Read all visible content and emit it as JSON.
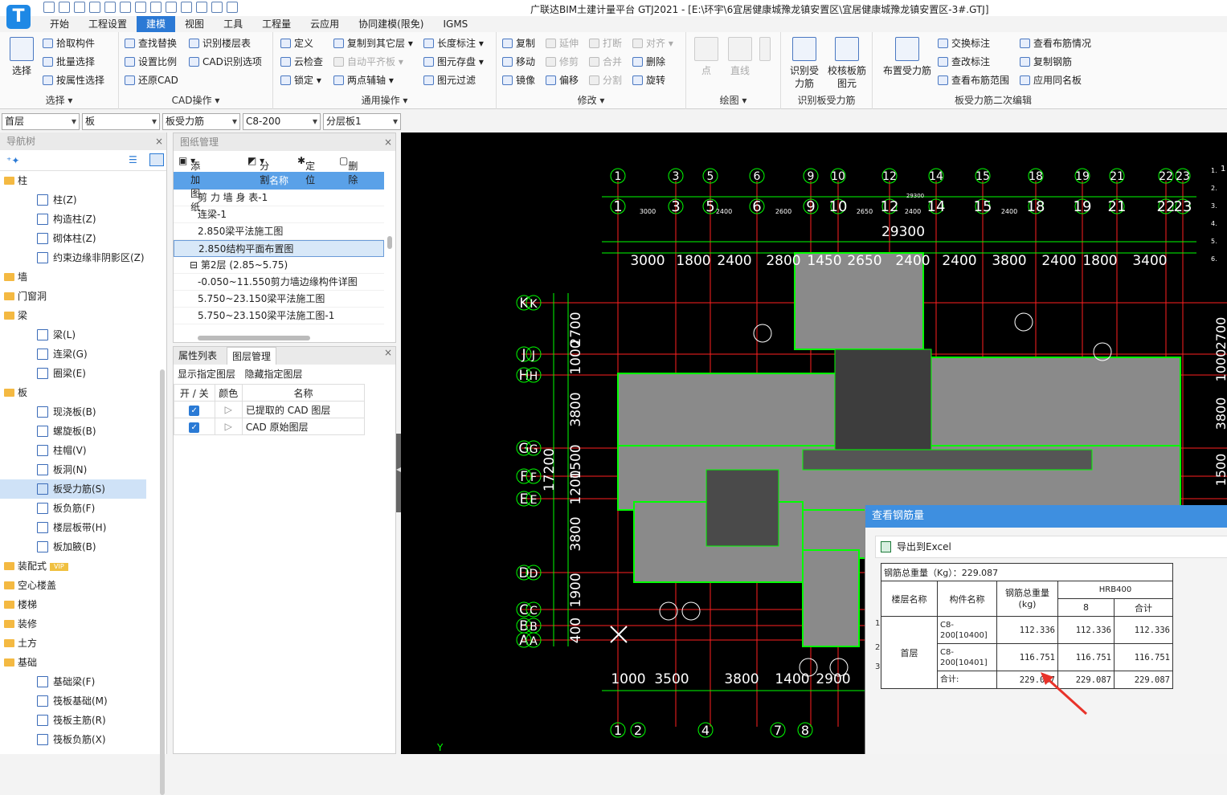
{
  "app": {
    "title": "广联达BIM土建计量平台 GTJ2021 - [E:\\环宇\\6宜居健康城豫龙镇安置区\\宜居健康城豫龙镇安置区-3#.GTJ]",
    "logo": "T"
  },
  "tabs": [
    "开始",
    "工程设置",
    "建模",
    "视图",
    "工具",
    "工程量",
    "云应用",
    "协同建模(限免)",
    "IGMS"
  ],
  "active_tab": "建模",
  "ribbon": {
    "select": {
      "label": "选择",
      "big": "选择",
      "items": [
        "拾取构件",
        "批量选择",
        "按属性选择"
      ]
    },
    "cad": {
      "label": "CAD操作",
      "items": [
        "查找替换",
        "设置比例",
        "还原CAD",
        "识别楼层表",
        "CAD识别选项"
      ]
    },
    "common": {
      "label": "通用操作",
      "items": [
        "定义",
        "云检查",
        "锁定",
        "复制到其它层",
        "自动平齐板",
        "两点辅轴",
        "长度标注",
        "图元存盘",
        "图元过滤"
      ]
    },
    "modify": {
      "label": "修改",
      "items": [
        "复制",
        "移动",
        "镜像",
        "延伸",
        "修剪",
        "偏移",
        "打断",
        "合并",
        "分割",
        "对齐",
        "删除",
        "旋转"
      ]
    },
    "draw": {
      "label": "绘图",
      "items": [
        "点",
        "直线"
      ]
    },
    "recog": {
      "label": "识别板受力筋",
      "items": [
        "识别受力筋",
        "校核板筋图元"
      ]
    },
    "secondary": {
      "label": "板受力筋二次编辑",
      "big": "布置受力筋",
      "items": [
        "交换标注",
        "查改标注",
        "查看布筋范围",
        "查看布筋情况",
        "复制钢筋",
        "应用同名板"
      ]
    }
  },
  "selectors": [
    "首层",
    "板",
    "板受力筋",
    "C8-200",
    "分层板1"
  ],
  "nav": {
    "title": "导航树",
    "items": [
      {
        "t": "g",
        "label": "柱"
      },
      {
        "t": "c",
        "label": "柱(Z)"
      },
      {
        "t": "c",
        "label": "构造柱(Z)"
      },
      {
        "t": "c",
        "label": "砌体柱(Z)"
      },
      {
        "t": "c",
        "label": "约束边缘非阴影区(Z)"
      },
      {
        "t": "g",
        "label": "墙"
      },
      {
        "t": "g",
        "label": "门窗洞"
      },
      {
        "t": "g",
        "label": "梁"
      },
      {
        "t": "c",
        "label": "梁(L)"
      },
      {
        "t": "c",
        "label": "连梁(G)"
      },
      {
        "t": "c",
        "label": "圈梁(E)"
      },
      {
        "t": "g",
        "label": "板"
      },
      {
        "t": "c",
        "label": "现浇板(B)"
      },
      {
        "t": "c",
        "label": "螺旋板(B)"
      },
      {
        "t": "c",
        "label": "柱帽(V)"
      },
      {
        "t": "c",
        "label": "板洞(N)"
      },
      {
        "t": "c",
        "label": "板受力筋(S)",
        "sel": true
      },
      {
        "t": "c",
        "label": "板负筋(F)"
      },
      {
        "t": "c",
        "label": "楼层板带(H)"
      },
      {
        "t": "c",
        "label": "板加腋(B)"
      },
      {
        "t": "g",
        "label": "装配式",
        "vip": "VIP"
      },
      {
        "t": "g",
        "label": "空心楼盖"
      },
      {
        "t": "g",
        "label": "楼梯"
      },
      {
        "t": "g",
        "label": "装修"
      },
      {
        "t": "g",
        "label": "土方"
      },
      {
        "t": "g",
        "label": "基础"
      },
      {
        "t": "c",
        "label": "基础梁(F)"
      },
      {
        "t": "c",
        "label": "筏板基础(M)"
      },
      {
        "t": "c",
        "label": "筏板主筋(R)"
      },
      {
        "t": "c",
        "label": "筏板负筋(X)"
      }
    ]
  },
  "drawings": {
    "title": "图纸管理",
    "tools": [
      "添加图纸",
      "分割",
      "定位",
      "删除"
    ],
    "col": "名称",
    "rows": [
      {
        "label": "剪 力 墙 身 表-1"
      },
      {
        "label": "连梁-1"
      },
      {
        "label": "2.850梁平法施工图"
      },
      {
        "label": "2.850结构平面布置图",
        "sel": true
      },
      {
        "label": "第2层 (2.85~5.75)",
        "grp": true
      },
      {
        "label": "-0.050~11.550剪力墙边缘构件详图"
      },
      {
        "label": "5.750~23.150梁平法施工图"
      },
      {
        "label": "5.750~23.150梁平法施工图-1"
      }
    ]
  },
  "layers": {
    "tabs": [
      "属性列表",
      "图层管理"
    ],
    "ops": [
      "显示指定图层",
      "隐藏指定图层"
    ],
    "headers": [
      "开 / 关",
      "颜色",
      "名称"
    ],
    "rows": [
      "已提取的 CAD 图层",
      "CAD 原始图层"
    ]
  },
  "cad": {
    "axes_top": [
      "1",
      "3",
      "5",
      "6",
      "9",
      "10",
      "12",
      "14",
      "15",
      "18",
      "19",
      "21",
      "22",
      "23"
    ],
    "dims_top": [
      "3000",
      "1800",
      "2400",
      "2800",
      "1450",
      "2650",
      "2400",
      "2400",
      "3800",
      "2400",
      "1800",
      "3400"
    ],
    "dims_top_small": [
      "3000",
      "2400",
      "2600",
      "2650",
      "2400",
      "2400"
    ],
    "total_top": "29300",
    "total_top_small": "29300",
    "axes_left": [
      "K",
      "J",
      "H",
      "G",
      "F",
      "E",
      "D",
      "C",
      "B",
      "A"
    ],
    "dims_left": [
      "2700",
      "1000",
      "3800",
      "1500",
      "1200",
      "3800",
      "1900",
      "400"
    ],
    "total_left": "17200",
    "axes_bottom": [
      "1",
      "2",
      "4",
      "7",
      "8"
    ],
    "dims_bottom": [
      "1000",
      "3500",
      "3800",
      "1400",
      "2900"
    ],
    "right_axis": "1",
    "rightdims": [
      "2700",
      "1000",
      "3800",
      "1500"
    ],
    "notes_right": [
      "1.",
      "2.",
      "3.",
      "4.",
      "5.",
      "6."
    ]
  },
  "dialog": {
    "title": "查看钢筋量",
    "export": "导出到Excel",
    "table": {
      "total_label": "钢筋总重量（Kg）：229.087",
      "h_floor": "楼层名称",
      "h_comp": "构件名称",
      "h_weight": "钢筋总重量(kg)",
      "h_grade": "HRB400",
      "h_dia": "8",
      "h_sum": "合计",
      "floor": "首层",
      "rows": [
        {
          "n": "1",
          "comp": "C8-200[10400]",
          "w": "112.336",
          "d8": "112.336",
          "sum": "112.336"
        },
        {
          "n": "2",
          "comp": "C8-200[10401]",
          "w": "116.751",
          "d8": "116.751",
          "sum": "116.751"
        },
        {
          "n": "3",
          "comp": "合计:",
          "w": "229.087",
          "d8": "229.087",
          "sum": "229.087"
        }
      ]
    }
  },
  "colors": {
    "accent": "#2b79d5",
    "axis": "#00ff00",
    "grid": "#ff2020",
    "arrow": "#e8332a",
    "dialog_title": "#3e8fe0"
  }
}
